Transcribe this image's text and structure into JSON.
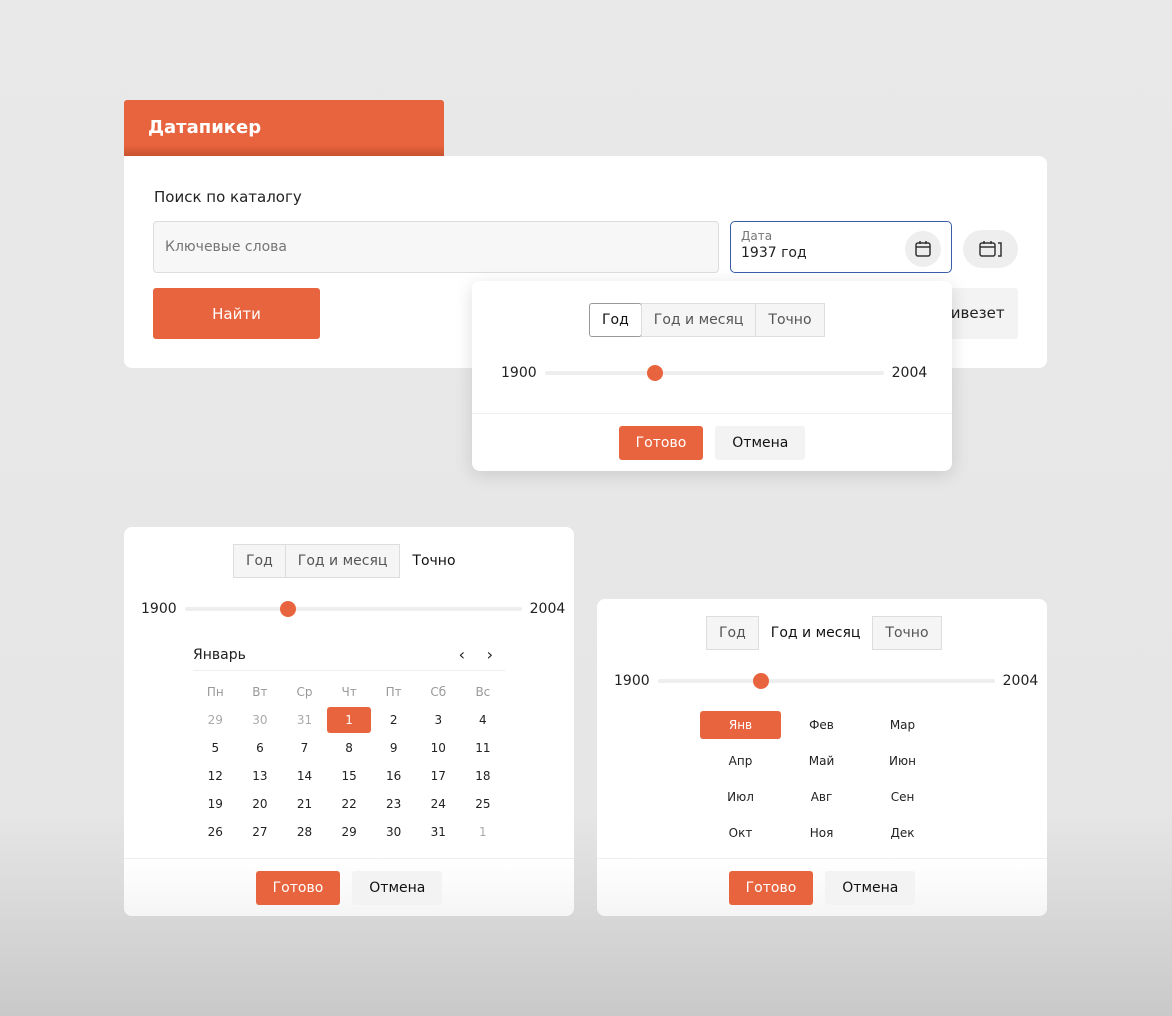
{
  "header": {
    "title": "Датапикер"
  },
  "search": {
    "label": "Поиск по каталогу",
    "keywords_placeholder": "Ключевые слова",
    "date_caption": "Дата",
    "date_value": "1937 год",
    "find": "Найти",
    "hidden_button": "Привезет"
  },
  "popover": {
    "modes": [
      "Год",
      "Год и месяц",
      "Точно"
    ],
    "active_mode": "Год",
    "range_min": "1900",
    "range_max": "2004",
    "slider_value": 1934,
    "ok": "Готово",
    "cancel": "Отмена"
  },
  "exact": {
    "modes": [
      "Год",
      "Год и месяц",
      "Точно"
    ],
    "active_mode": "Точно",
    "range_min": "1900",
    "range_max": "2004",
    "slider_value": 1932,
    "month": "Январь",
    "weekdays": [
      "Пн",
      "Вт",
      "Ср",
      "Чт",
      "Пт",
      "Сб",
      "Вс"
    ],
    "weeks": [
      [
        "29",
        "30",
        "31",
        "1",
        "2",
        "3",
        "4"
      ],
      [
        "5",
        "6",
        "7",
        "8",
        "9",
        "10",
        "11"
      ],
      [
        "12",
        "13",
        "14",
        "15",
        "16",
        "17",
        "18"
      ],
      [
        "19",
        "20",
        "21",
        "22",
        "23",
        "24",
        "25"
      ],
      [
        "26",
        "27",
        "28",
        "29",
        "30",
        "31",
        "1"
      ]
    ],
    "selected_day": "1",
    "ok": "Готово",
    "cancel": "Отмена"
  },
  "month_mode": {
    "modes": [
      "Год",
      "Год и месяц",
      "Точно"
    ],
    "active_mode": "Год и месяц",
    "range_min": "1900",
    "range_max": "2004",
    "slider_value": 1932,
    "months": [
      "Янв",
      "Фев",
      "Мар",
      "Апр",
      "Май",
      "Июн",
      "Июл",
      "Авг",
      "Сен",
      "Окт",
      "Ноя",
      "Дек"
    ],
    "selected_month": "Янв",
    "ok": "Готово",
    "cancel": "Отмена"
  },
  "colors": {
    "accent": "#e8643e",
    "focus": "#3a5ea8"
  }
}
